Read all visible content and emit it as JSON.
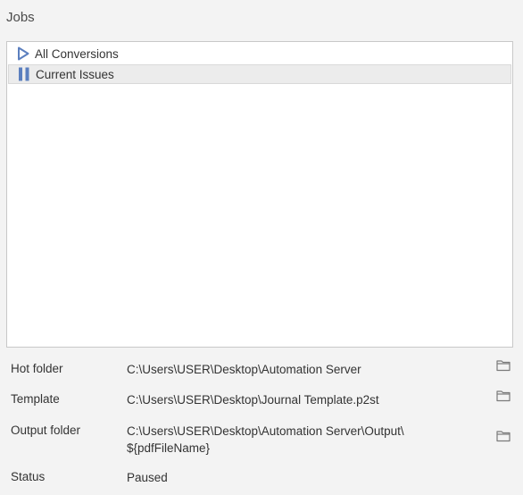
{
  "section": {
    "title": "Jobs"
  },
  "jobs": [
    {
      "name": "All Conversions",
      "state": "play-icon"
    },
    {
      "name": "Current Issues",
      "state": "pause-icon",
      "selected": true
    }
  ],
  "properties": {
    "hot_folder": {
      "label": "Hot folder",
      "value": "C:\\Users\\USER\\Desktop\\Automation Server"
    },
    "template": {
      "label": "Template",
      "value": "C:\\Users\\USER\\Desktop\\Journal Template.p2st"
    },
    "output_folder": {
      "label": "Output folder",
      "value_line1": "C:\\Users\\USER\\Desktop\\Automation Server\\Output\\",
      "value_line2": "${pdfFileName}"
    },
    "status": {
      "label": "Status",
      "value": "Paused"
    }
  },
  "colors": {
    "icon_accent": "#5b7fbf",
    "folder_icon": "#7a7a7a"
  }
}
